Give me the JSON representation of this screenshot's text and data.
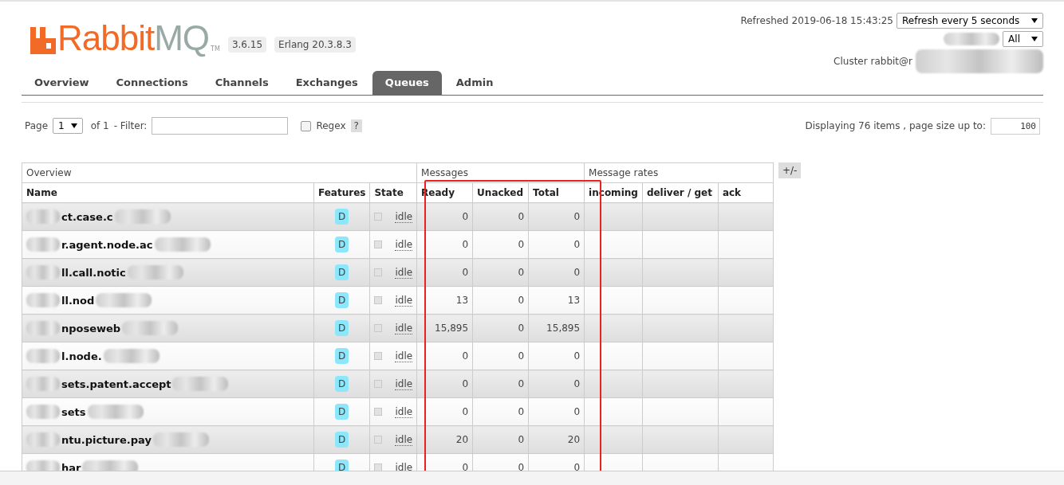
{
  "logo": {
    "primary": "Rabbit",
    "secondary": "MQ",
    "mark": "TM"
  },
  "versions": [
    "3.6.15",
    "Erlang 20.3.8.3"
  ],
  "refreshed": "Refreshed 2019-06-18 15:43:25",
  "refresh_select": "Refresh every 5 seconds",
  "vhost_select": "All",
  "cluster": "Cluster rabbit@r",
  "tabs": [
    {
      "label": "Overview",
      "selected": false
    },
    {
      "label": "Connections",
      "selected": false
    },
    {
      "label": "Channels",
      "selected": false
    },
    {
      "label": "Exchanges",
      "selected": false
    },
    {
      "label": "Queues",
      "selected": true
    },
    {
      "label": "Admin",
      "selected": false
    }
  ],
  "pagination": {
    "page_label": "Page",
    "page": "1",
    "of": "of 1",
    "filter_label": "- Filter:",
    "regex_label": "Regex",
    "regex_checked": false,
    "help": "?",
    "displaying": "Displaying 76 items , page size up to:",
    "page_size": "100"
  },
  "table": {
    "groups": [
      {
        "label": "Overview"
      },
      {
        "label": "Messages"
      },
      {
        "label": "Message rates"
      }
    ],
    "columns": [
      "Name",
      "Features",
      "State",
      "Ready",
      "Unacked",
      "Total",
      "incoming",
      "deliver / get",
      "ack"
    ],
    "rows": [
      {
        "name": "ct.case.c",
        "feature": "D",
        "state": "idle",
        "ready": "0",
        "unacked": "0",
        "total": "0"
      },
      {
        "name": "r.agent.node.ac",
        "feature": "D",
        "state": "idle",
        "ready": "0",
        "unacked": "0",
        "total": "0"
      },
      {
        "name": "ll.call.notic",
        "feature": "D",
        "state": "idle",
        "ready": "0",
        "unacked": "0",
        "total": "0"
      },
      {
        "name": "ll.nod",
        "feature": "D",
        "state": "idle",
        "ready": "13",
        "unacked": "0",
        "total": "13"
      },
      {
        "name": "nposeweb",
        "feature": "D",
        "state": "idle",
        "ready": "15,895",
        "unacked": "0",
        "total": "15,895"
      },
      {
        "name": "l.node.",
        "feature": "D",
        "state": "idle",
        "ready": "0",
        "unacked": "0",
        "total": "0"
      },
      {
        "name": "sets.patent.accept",
        "feature": "D",
        "state": "idle",
        "ready": "0",
        "unacked": "0",
        "total": "0"
      },
      {
        "name": "sets",
        "feature": "D",
        "state": "idle",
        "ready": "0",
        "unacked": "0",
        "total": "0"
      },
      {
        "name": "ntu.picture.pay",
        "feature": "D",
        "state": "idle",
        "ready": "20",
        "unacked": "0",
        "total": "20"
      },
      {
        "name": "har",
        "feature": "D",
        "state": "idle",
        "ready": "0",
        "unacked": "0",
        "total": "0"
      }
    ]
  },
  "columns_toggle": "+/-"
}
